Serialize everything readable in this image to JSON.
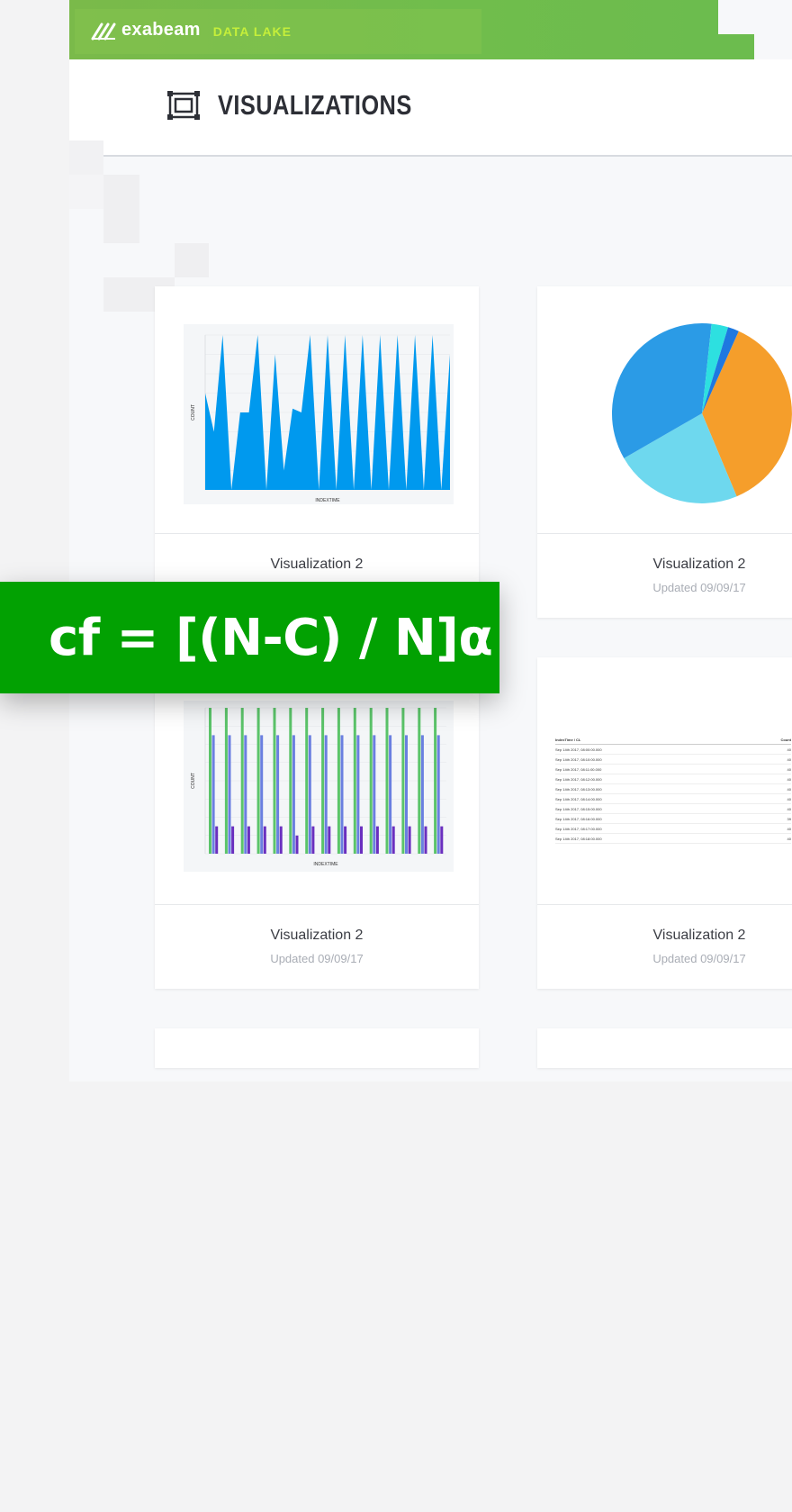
{
  "brand": {
    "name": "exabeam",
    "product": "DATA LAKE"
  },
  "header": {
    "title": "VISUALIZATIONS",
    "icon": "visualization-frame-icon"
  },
  "overlay": {
    "formula": "cf = [(N-C) / N]α"
  },
  "cards": [
    {
      "title": "Visualization 2",
      "updated": "",
      "preview": "area-chart"
    },
    {
      "title": "Visualization 2",
      "updated": "Updated 09/09/17",
      "preview": "pie-chart"
    },
    {
      "title": "Visualization 2",
      "updated": "Updated 09/09/17",
      "preview": "grouped-bar-chart"
    },
    {
      "title": "Visualization 2",
      "updated": "Updated 09/09/17",
      "preview": "table"
    }
  ],
  "table_preview": {
    "columns": [
      "IndexTime / CL",
      "Count"
    ],
    "rows": [
      [
        "Sep 14th 2017, 08:00:00.000",
        "40"
      ],
      [
        "Sep 14th 2017, 08:10:00.000",
        "40"
      ],
      [
        "Sep 14th 2017, 08:11:00.000",
        "40"
      ],
      [
        "Sep 14th 2017, 08:12:00.000",
        "40"
      ],
      [
        "Sep 14th 2017, 08:13:00.000",
        "40"
      ],
      [
        "Sep 14th 2017, 08:14:00.000",
        "40"
      ],
      [
        "Sep 14th 2017, 08:15:00.000",
        "40"
      ],
      [
        "Sep 14th 2017, 08:16:00.000",
        "39"
      ],
      [
        "Sep 14th 2017, 08:17:00.000",
        "40"
      ],
      [
        "Sep 14th 2017, 08:18:00.000",
        "40"
      ]
    ]
  },
  "chart_data": [
    {
      "type": "area",
      "xlabel": "INDEXTIME",
      "ylabel": "COUNT",
      "ylim": [
        0,
        40
      ],
      "values": [
        25,
        15,
        40,
        0,
        20,
        20,
        40,
        0,
        35,
        5,
        21,
        20,
        40,
        0,
        40,
        0,
        40,
        0,
        40,
        0,
        40,
        0,
        40,
        0,
        40,
        0,
        40,
        0,
        35
      ],
      "color": "#0099ee"
    },
    {
      "type": "pie",
      "slices": [
        {
          "value": 37,
          "color": "#f59e2b"
        },
        {
          "value": 23,
          "color": "#6ed8ee"
        },
        {
          "value": 35,
          "color": "#2b9be6"
        },
        {
          "value": 3,
          "color": "#2de0e0"
        },
        {
          "value": 2,
          "color": "#1e78e0"
        }
      ]
    },
    {
      "type": "bar",
      "xlabel": "INDEXTIME",
      "ylabel": "COUNT",
      "ylim": [
        0,
        16
      ],
      "series": [
        {
          "values": [
            16,
            16,
            16,
            16,
            16,
            16,
            16,
            16,
            16,
            16,
            16,
            16,
            16,
            16,
            16
          ],
          "color": "#5bc46a"
        },
        {
          "values": [
            13,
            13,
            13,
            13,
            13,
            13,
            13,
            13,
            13,
            13,
            13,
            13,
            13,
            13,
            13
          ],
          "color": "#6a7fe0"
        },
        {
          "values": [
            3,
            3,
            3,
            3,
            3,
            2,
            3,
            3,
            3,
            3,
            3,
            3,
            3,
            3,
            3
          ],
          "color": "#6a2fbf"
        }
      ]
    }
  ]
}
